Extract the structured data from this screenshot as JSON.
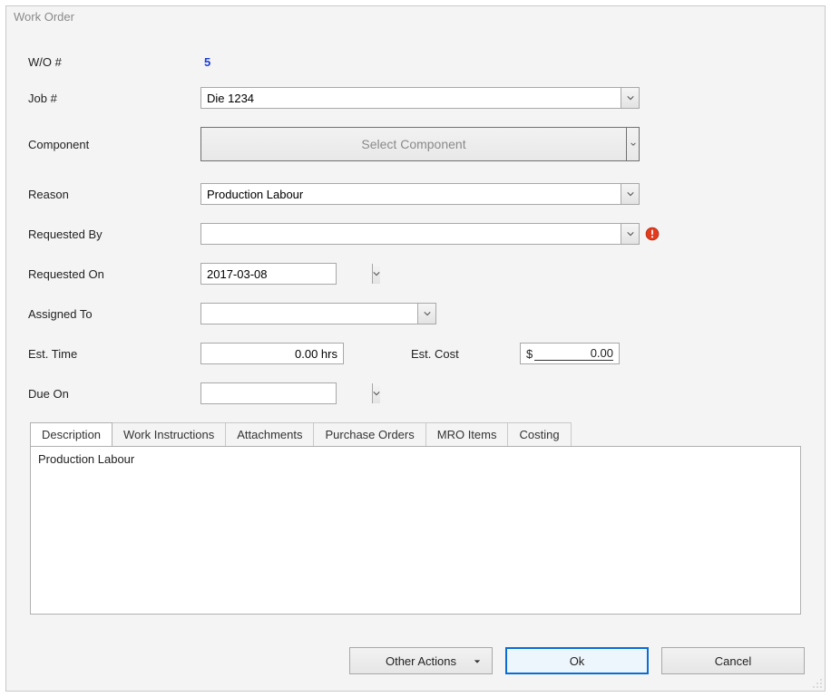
{
  "window": {
    "title": "Work Order"
  },
  "form": {
    "wo_label": "W/O #",
    "wo_value": "5",
    "job_label": "Job #",
    "job_value": "Die 1234",
    "component_label": "Component",
    "component_placeholder": "Select Component",
    "reason_label": "Reason",
    "reason_value": "Production Labour",
    "requested_by_label": "Requested By",
    "requested_by_value": "",
    "requested_on_label": "Requested On",
    "requested_on_value": "2017-03-08",
    "assigned_to_label": "Assigned To",
    "assigned_to_value": "",
    "est_time_label": "Est. Time",
    "est_time_value": "0.00 hrs",
    "est_cost_label": "Est. Cost",
    "est_cost_prefix": "$",
    "est_cost_value": "0.00",
    "due_on_label": "Due On",
    "due_on_value": ""
  },
  "tabs": {
    "items": [
      "Description",
      "Work Instructions",
      "Attachments",
      "Purchase Orders",
      "MRO Items",
      "Costing"
    ],
    "active_index": 0,
    "description_body": "Production Labour"
  },
  "buttons": {
    "other_actions": "Other Actions",
    "ok": "Ok",
    "cancel": "Cancel"
  }
}
